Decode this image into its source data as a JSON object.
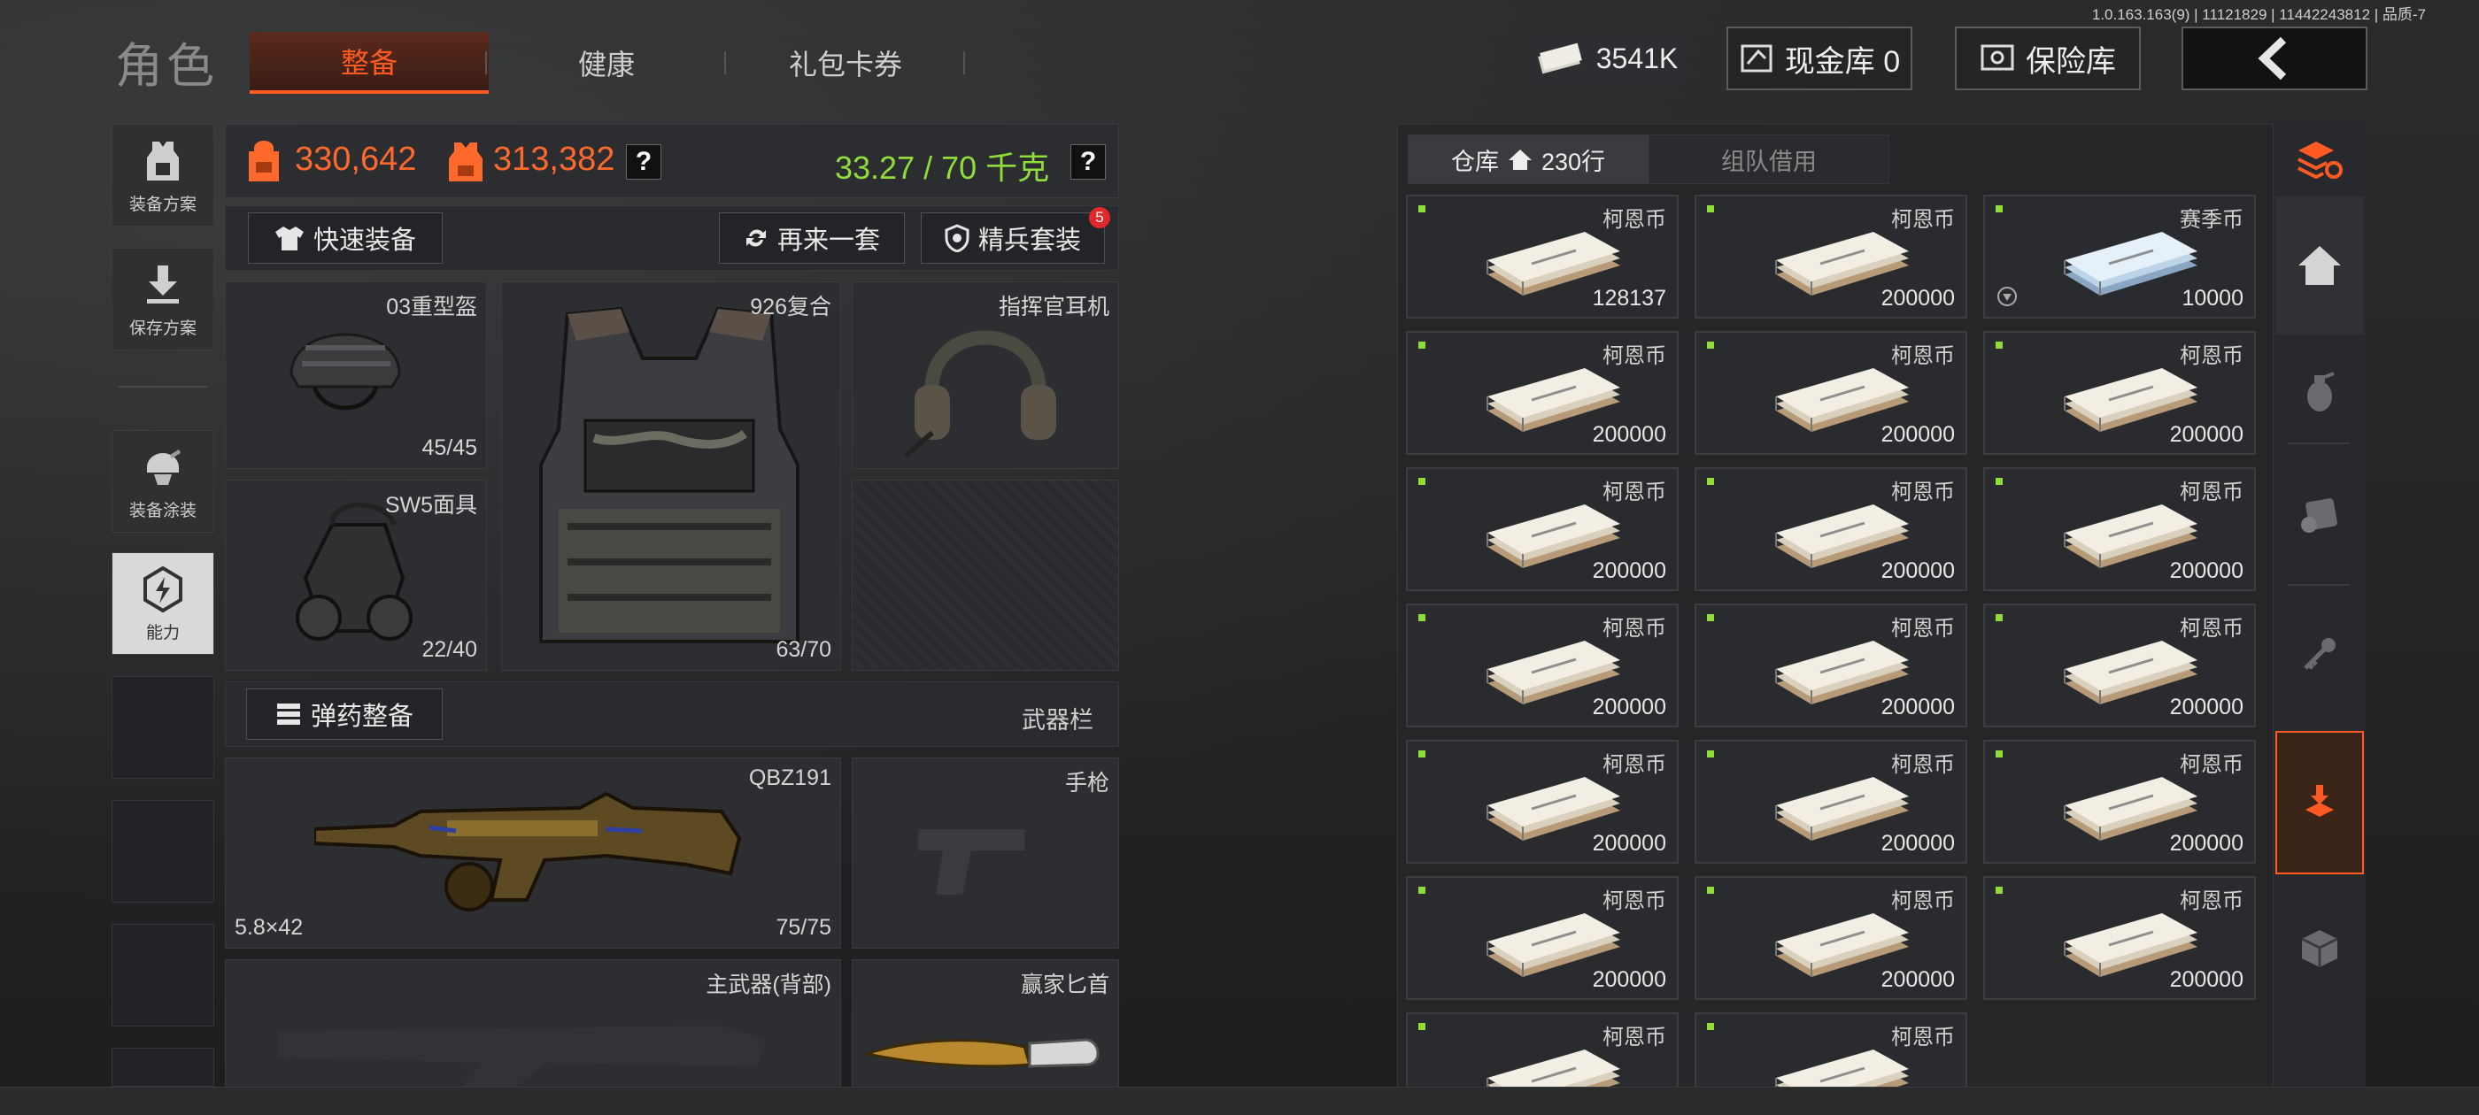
{
  "version": "1.0.163.163(9) | 11121829 | 11442243812 | 品质-7",
  "header": {
    "title": "角色",
    "tabs": [
      {
        "label": "整备",
        "active": true
      },
      {
        "label": "健康",
        "active": false
      },
      {
        "label": "礼包卡券",
        "active": false
      }
    ],
    "money": "3541K",
    "cash_vault": "现金库 0",
    "safe_box": "保险库"
  },
  "sidebar": {
    "items": [
      {
        "label": "装备方案",
        "icon": "vest-plan-icon"
      },
      {
        "label": "保存方案",
        "icon": "download-icon"
      },
      {
        "label": "装备涂装",
        "icon": "paint-helmet-icon"
      },
      {
        "label": "能力",
        "icon": "lightning-hexagon-icon"
      }
    ]
  },
  "stats": {
    "value_bag": "330,642",
    "value_armor": "313,382",
    "help": "?",
    "weight": "33.27 / 70 千克"
  },
  "buttons": {
    "quick_equip": "快速装备",
    "again": "再来一套",
    "elite": "精兵套装",
    "elite_badge": "5",
    "ammo": "弹药整备",
    "weapon_bar": "武器栏"
  },
  "equipment": {
    "helmet": {
      "name": "03重型盔",
      "durability": "45/45"
    },
    "armor": {
      "name": "926复合",
      "durability": "63/70"
    },
    "headset": {
      "name": "指挥官耳机"
    },
    "mask": {
      "name": "SW5面具",
      "durability": "22/40"
    }
  },
  "weapons": {
    "primary": {
      "name": "QBZ191",
      "ammo": "5.8×42",
      "durability": "75/75"
    },
    "pistol": {
      "name": "手枪"
    },
    "back": {
      "name": "主武器(背部)"
    },
    "melee": {
      "name": "赢家匕首"
    }
  },
  "warehouse": {
    "tab_storage": "仓库",
    "rows": "230行",
    "tab_team": "组队借用",
    "items": [
      {
        "name": "柯恩币",
        "qty": "128137",
        "kind": "coin"
      },
      {
        "name": "柯恩币",
        "qty": "200000",
        "kind": "coin"
      },
      {
        "name": "赛季币",
        "qty": "10000",
        "kind": "season"
      },
      {
        "name": "柯恩币",
        "qty": "200000",
        "kind": "coin"
      },
      {
        "name": "柯恩币",
        "qty": "200000",
        "kind": "coin"
      },
      {
        "name": "柯恩币",
        "qty": "200000",
        "kind": "coin"
      },
      {
        "name": "柯恩币",
        "qty": "200000",
        "kind": "coin"
      },
      {
        "name": "柯恩币",
        "qty": "200000",
        "kind": "coin"
      },
      {
        "name": "柯恩币",
        "qty": "200000",
        "kind": "coin"
      },
      {
        "name": "柯恩币",
        "qty": "200000",
        "kind": "coin"
      },
      {
        "name": "柯恩币",
        "qty": "200000",
        "kind": "coin"
      },
      {
        "name": "柯恩币",
        "qty": "200000",
        "kind": "coin"
      },
      {
        "name": "柯恩币",
        "qty": "200000",
        "kind": "coin"
      },
      {
        "name": "柯恩币",
        "qty": "200000",
        "kind": "coin"
      },
      {
        "name": "柯恩币",
        "qty": "200000",
        "kind": "coin"
      },
      {
        "name": "柯恩币",
        "qty": "200000",
        "kind": "coin"
      },
      {
        "name": "柯恩币",
        "qty": "200000",
        "kind": "coin"
      },
      {
        "name": "柯恩币",
        "qty": "200000",
        "kind": "coin"
      },
      {
        "name": "柯恩币",
        "qty": "",
        "kind": "coin"
      },
      {
        "name": "柯恩币",
        "qty": "",
        "kind": "coin"
      }
    ]
  },
  "colors": {
    "accent": "#ff5a22",
    "green": "#8fdc3a"
  }
}
